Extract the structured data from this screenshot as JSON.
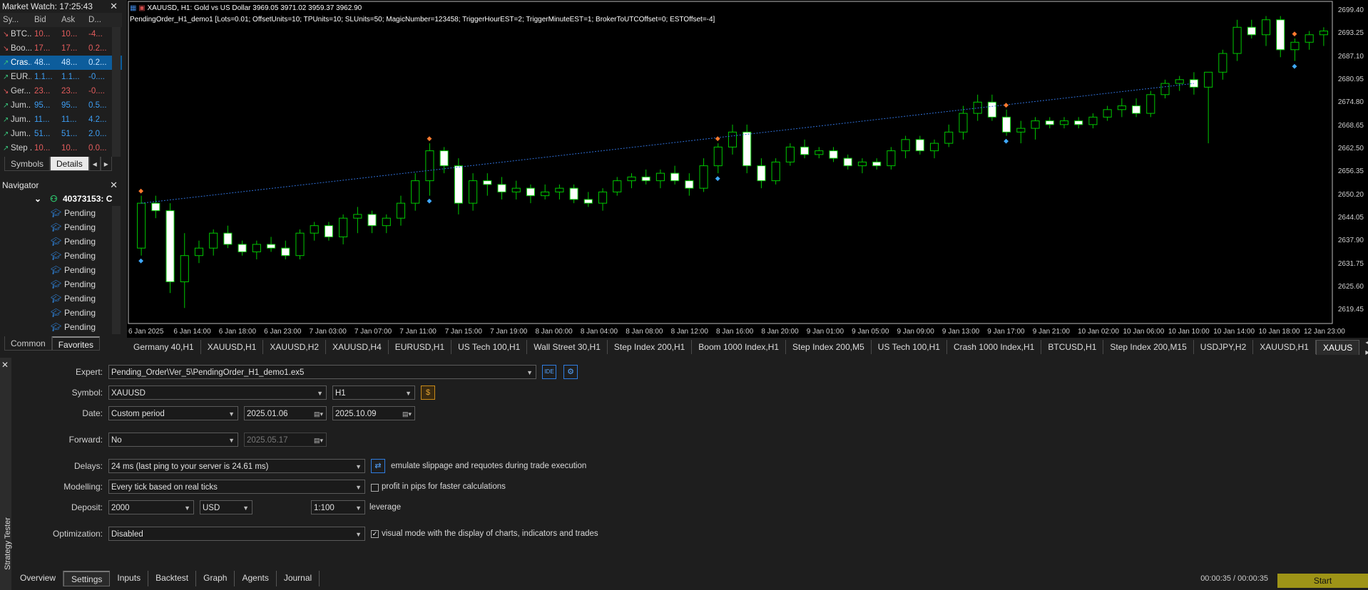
{
  "market_watch": {
    "title": "Market Watch: 17:25:43",
    "columns": [
      "Sy...",
      "Bid",
      "Ask",
      "D..."
    ],
    "rows": [
      {
        "dir": "down",
        "symbol": "BTC...",
        "bid": "10...",
        "ask": "10...",
        "delta": "-4...",
        "color": "red"
      },
      {
        "dir": "down",
        "symbol": "Boo...",
        "bid": "17...",
        "ask": "17...",
        "delta": "0.2...",
        "color": "red"
      },
      {
        "dir": "up",
        "symbol": "Cras...",
        "bid": "48...",
        "ask": "48...",
        "delta": "0.2...",
        "color": "blue",
        "selected": true
      },
      {
        "dir": "up",
        "symbol": "EUR...",
        "bid": "1.1...",
        "ask": "1.1...",
        "delta": "-0....",
        "color": "blue"
      },
      {
        "dir": "down",
        "symbol": "Ger...",
        "bid": "23...",
        "ask": "23...",
        "delta": "-0....",
        "color": "red"
      },
      {
        "dir": "up",
        "symbol": "Jum...",
        "bid": "95...",
        "ask": "95...",
        "delta": "0.5...",
        "color": "blue"
      },
      {
        "dir": "up",
        "symbol": "Jum...",
        "bid": "11...",
        "ask": "11...",
        "delta": "4.2...",
        "color": "blue"
      },
      {
        "dir": "up",
        "symbol": "Jum...",
        "bid": "51...",
        "ask": "51...",
        "delta": "2.0...",
        "color": "blue"
      },
      {
        "dir": "up",
        "symbol": "Step ...",
        "bid": "10...",
        "ask": "10...",
        "delta": "0.0...",
        "color": "red"
      }
    ],
    "tabs": [
      "Symbols",
      "Details"
    ]
  },
  "navigator": {
    "title": "Navigator",
    "account": "40373153: C",
    "items": [
      "Pending",
      "Pending",
      "Pending",
      "Pending",
      "Pending",
      "Pending",
      "Pending",
      "Pending",
      "Pending"
    ],
    "tabs": [
      "Common",
      "Favorites"
    ]
  },
  "chart": {
    "symbol_line": "XAUUSD, H1:  Gold vs US Dollar  3969.05 3971.02 3959.37 3962.90",
    "params_line": "PendingOrder_H1_demo1 [Lots=0.01; OffsetUnits=10; TPUnits=10; SLUnits=50; MagicNumber=123458; TriggerHourEST=2; TriggerMinuteEST=1; BrokerToUTCOffset=0; ESTOffset=-4]",
    "colors": {
      "bull": "#00c800",
      "bear": "#ffffff",
      "trend": "#2f6fd6"
    }
  },
  "chart_data": {
    "type": "candlestick",
    "y_tick_labels": [
      "2699.40",
      "2693.25",
      "2687.10",
      "2680.95",
      "2674.80",
      "2668.65",
      "2662.50",
      "2656.35",
      "2650.20",
      "2644.05",
      "2637.90",
      "2631.75",
      "2625.60",
      "2619.45"
    ],
    "x_tick_labels": [
      "6 Jan 2025",
      "6 Jan 14:00",
      "6 Jan 18:00",
      "6 Jan 23:00",
      "7 Jan 03:00",
      "7 Jan 07:00",
      "7 Jan 11:00",
      "7 Jan 15:00",
      "7 Jan 19:00",
      "8 Jan 00:00",
      "8 Jan 04:00",
      "8 Jan 08:00",
      "8 Jan 12:00",
      "8 Jan 16:00",
      "8 Jan 20:00",
      "9 Jan 01:00",
      "9 Jan 05:00",
      "9 Jan 09:00",
      "9 Jan 13:00",
      "9 Jan 17:00",
      "9 Jan 21:00",
      "10 Jan 02:00",
      "10 Jan 06:00",
      "10 Jan 10:00",
      "10 Jan 14:00",
      "10 Jan 18:00",
      "12 Jan 23:00"
    ],
    "ohlc": [
      [
        2636,
        2650,
        2634,
        2648
      ],
      [
        2648,
        2650,
        2644,
        2646
      ],
      [
        2646,
        2648,
        2624,
        2627
      ],
      [
        2627,
        2640,
        2620,
        2634
      ],
      [
        2634,
        2638,
        2632,
        2636
      ],
      [
        2636,
        2641,
        2634,
        2640
      ],
      [
        2640,
        2642,
        2636,
        2637
      ],
      [
        2637,
        2638,
        2634,
        2635
      ],
      [
        2635,
        2638,
        2633,
        2637
      ],
      [
        2637,
        2639,
        2635,
        2636
      ],
      [
        2636,
        2638,
        2633,
        2634
      ],
      [
        2634,
        2641,
        2633,
        2640
      ],
      [
        2640,
        2643,
        2638,
        2642
      ],
      [
        2642,
        2643,
        2638,
        2639
      ],
      [
        2639,
        2645,
        2637,
        2644
      ],
      [
        2644,
        2647,
        2640,
        2645
      ],
      [
        2645,
        2646,
        2640,
        2642
      ],
      [
        2642,
        2645,
        2640,
        2644
      ],
      [
        2644,
        2650,
        2642,
        2648
      ],
      [
        2648,
        2656,
        2646,
        2654
      ],
      [
        2654,
        2664,
        2650,
        2662
      ],
      [
        2662,
        2663,
        2656,
        2658
      ],
      [
        2658,
        2660,
        2645,
        2648
      ],
      [
        2648,
        2656,
        2646,
        2654
      ],
      [
        2654,
        2656,
        2650,
        2653
      ],
      [
        2653,
        2655,
        2649,
        2651
      ],
      [
        2651,
        2654,
        2649,
        2652
      ],
      [
        2652,
        2653,
        2648,
        2650
      ],
      [
        2650,
        2653,
        2649,
        2651
      ],
      [
        2651,
        2653,
        2649,
        2652
      ],
      [
        2652,
        2653,
        2648,
        2649
      ],
      [
        2649,
        2651,
        2647,
        2648
      ],
      [
        2648,
        2652,
        2646,
        2651
      ],
      [
        2651,
        2655,
        2650,
        2654
      ],
      [
        2654,
        2656,
        2652,
        2655
      ],
      [
        2655,
        2657,
        2653,
        2654
      ],
      [
        2654,
        2657,
        2652,
        2656
      ],
      [
        2656,
        2658,
        2653,
        2654
      ],
      [
        2654,
        2656,
        2650,
        2652
      ],
      [
        2652,
        2660,
        2651,
        2658
      ],
      [
        2658,
        2664,
        2656,
        2663
      ],
      [
        2663,
        2669,
        2661,
        2667
      ],
      [
        2667,
        2669,
        2656,
        2658
      ],
      [
        2658,
        2660,
        2652,
        2654
      ],
      [
        2654,
        2660,
        2653,
        2659
      ],
      [
        2659,
        2664,
        2658,
        2663
      ],
      [
        2663,
        2665,
        2660,
        2661
      ],
      [
        2661,
        2663,
        2660,
        2662
      ],
      [
        2662,
        2663,
        2659,
        2660
      ],
      [
        2660,
        2661,
        2657,
        2658
      ],
      [
        2658,
        2660,
        2656,
        2659
      ],
      [
        2659,
        2660,
        2657,
        2658
      ],
      [
        2658,
        2663,
        2657,
        2662
      ],
      [
        2662,
        2666,
        2660,
        2665
      ],
      [
        2665,
        2666,
        2661,
        2662
      ],
      [
        2662,
        2665,
        2660,
        2664
      ],
      [
        2664,
        2669,
        2663,
        2667
      ],
      [
        2667,
        2674,
        2665,
        2672
      ],
      [
        2672,
        2677,
        2670,
        2675
      ],
      [
        2675,
        2677,
        2670,
        2671
      ],
      [
        2671,
        2673,
        2666,
        2667
      ],
      [
        2667,
        2670,
        2664,
        2668
      ],
      [
        2668,
        2671,
        2665,
        2670
      ],
      [
        2670,
        2671,
        2668,
        2669
      ],
      [
        2669,
        2671,
        2668,
        2670
      ],
      [
        2670,
        2671,
        2668,
        2669
      ],
      [
        2669,
        2672,
        2668,
        2671
      ],
      [
        2671,
        2674,
        2670,
        2673
      ],
      [
        2673,
        2676,
        2671,
        2674
      ],
      [
        2674,
        2676,
        2671,
        2672
      ],
      [
        2672,
        2678,
        2671,
        2677
      ],
      [
        2677,
        2681,
        2676,
        2680
      ],
      [
        2680,
        2682,
        2678,
        2681
      ],
      [
        2681,
        2683,
        2677,
        2679
      ],
      [
        2679,
        2681,
        2664,
        2683
      ],
      [
        2683,
        2689,
        2681,
        2688
      ],
      [
        2688,
        2697,
        2686,
        2695
      ],
      [
        2695,
        2697,
        2692,
        2693
      ],
      [
        2693,
        2698,
        2690,
        2697
      ],
      [
        2697,
        2698,
        2687,
        2689
      ],
      [
        2689,
        2692,
        2686,
        2691
      ],
      [
        2691,
        2694,
        2689,
        2693
      ],
      [
        2693,
        2695,
        2690,
        2694
      ]
    ],
    "markers": [
      0,
      20,
      40,
      60,
      80
    ],
    "ylim": [
      2617,
      2700
    ]
  },
  "chart_tabs": [
    "Germany 40,H1",
    "XAUUSD,H1",
    "XAUUSD,H2",
    "XAUUSD,H4",
    "EURUSD,H1",
    "US Tech 100,H1",
    "Wall Street 30,H1",
    "Step Index 200,H1",
    "Boom 1000 Index,H1",
    "Step Index 200,M5",
    "US Tech 100,H1",
    "Crash 1000 Index,H1",
    "BTCUSD,H1",
    "Step Index 200,M15",
    "USDJPY,H2",
    "XAUUSD,H1",
    "XAUUS"
  ],
  "chart_tabs_active": 16,
  "tester": {
    "side_label": "Strategy Tester",
    "expert_label": "Expert:",
    "expert_value": "Pending_Order\\Ver_5\\PendingOrder_H1_demo1.ex5",
    "ide_label": "IDE",
    "symbol_label": "Symbol:",
    "symbol_value": "XAUUSD",
    "timeframe_value": "H1",
    "date_label": "Date:",
    "date_mode": "Custom period",
    "date_from": "2025.01.06",
    "date_to": "2025.10.09",
    "forward_label": "Forward:",
    "forward_value": "No",
    "forward_date": "2025.05.17",
    "delays_label": "Delays:",
    "delays_value": "24 ms (last ping to your server is 24.61 ms)",
    "delays_note": "emulate slippage and requotes during trade execution",
    "modelling_label": "Modelling:",
    "modelling_value": "Every tick based on real ticks",
    "pips_note": "profit in pips for faster calculations",
    "deposit_label": "Deposit:",
    "deposit_value": "2000",
    "currency_value": "USD",
    "leverage_value": "1:100",
    "leverage_note": "leverage",
    "optimization_label": "Optimization:",
    "optimization_value": "Disabled",
    "visual_note": "visual mode with the display of charts, indicators and trades",
    "tabs": [
      "Overview",
      "Settings",
      "Inputs",
      "Backtest",
      "Graph",
      "Agents",
      "Journal"
    ],
    "active_tab": "Settings",
    "timer": "00:00:35 / 00:00:35",
    "start_label": "Start"
  }
}
